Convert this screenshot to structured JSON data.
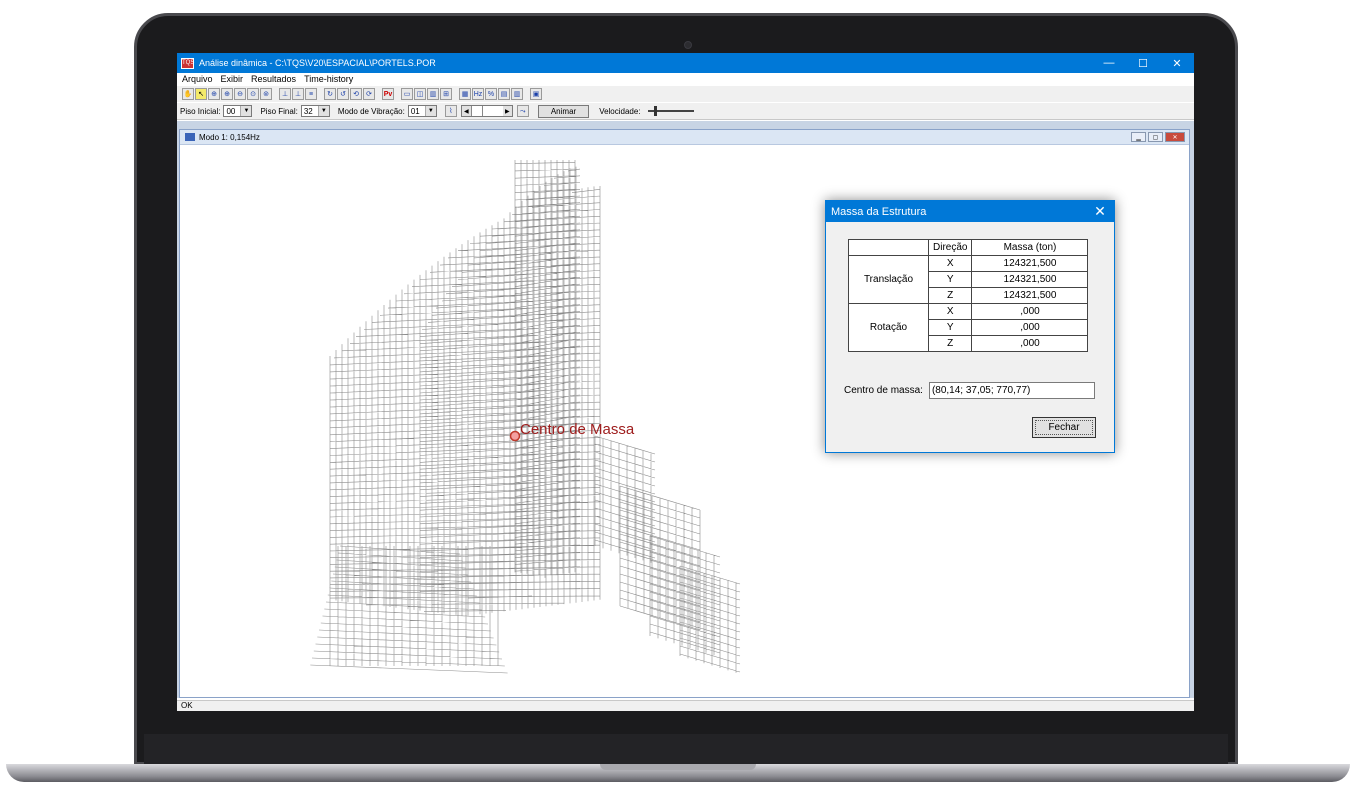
{
  "window": {
    "title": "Análise dinâmica - C:\\TQS\\V20\\ESPACIAL\\PORTELS.POR",
    "app_icon_text": "TQS",
    "min_glyph": "—",
    "max_glyph": "☐",
    "close_glyph": "✕"
  },
  "menu": [
    "Arquivo",
    "Exibir",
    "Resultados",
    "Time-history"
  ],
  "toolbar2": {
    "piso_inicial_label": "Piso Inicial:",
    "piso_inicial_value": "00",
    "piso_final_label": "Piso Final:",
    "piso_final_value": "32",
    "modo_label": "Modo de Vibração:",
    "modo_value": "01",
    "animar_label": "Animar",
    "velocidade_label": "Velocidade:"
  },
  "child_window": {
    "title": "Modo 1: 0,154Hz"
  },
  "viewport": {
    "centro_label": "Centro de Massa",
    "marker_color": "#c0392b"
  },
  "status": {
    "text": "OK"
  },
  "dialog": {
    "title": "Massa da Estrutura",
    "close_glyph": "✕",
    "headers": {
      "direcao": "Direção",
      "massa": "Massa (ton)"
    },
    "groups": [
      {
        "name": "Translação",
        "rows": [
          {
            "dir": "X",
            "value": "124321,500"
          },
          {
            "dir": "Y",
            "value": "124321,500"
          },
          {
            "dir": "Z",
            "value": "124321,500"
          }
        ]
      },
      {
        "name": "Rotação",
        "rows": [
          {
            "dir": "X",
            "value": ",000"
          },
          {
            "dir": "Y",
            "value": ",000"
          },
          {
            "dir": "Z",
            "value": ",000"
          }
        ]
      }
    ],
    "centro_label": "Centro de massa:",
    "centro_value": "(80,14; 37,05; 770,77)",
    "fechar_label": "Fechar"
  },
  "colors": {
    "accent": "#0078d7",
    "structure": "#8c8c8c",
    "centro_text": "#9e1c1c"
  }
}
